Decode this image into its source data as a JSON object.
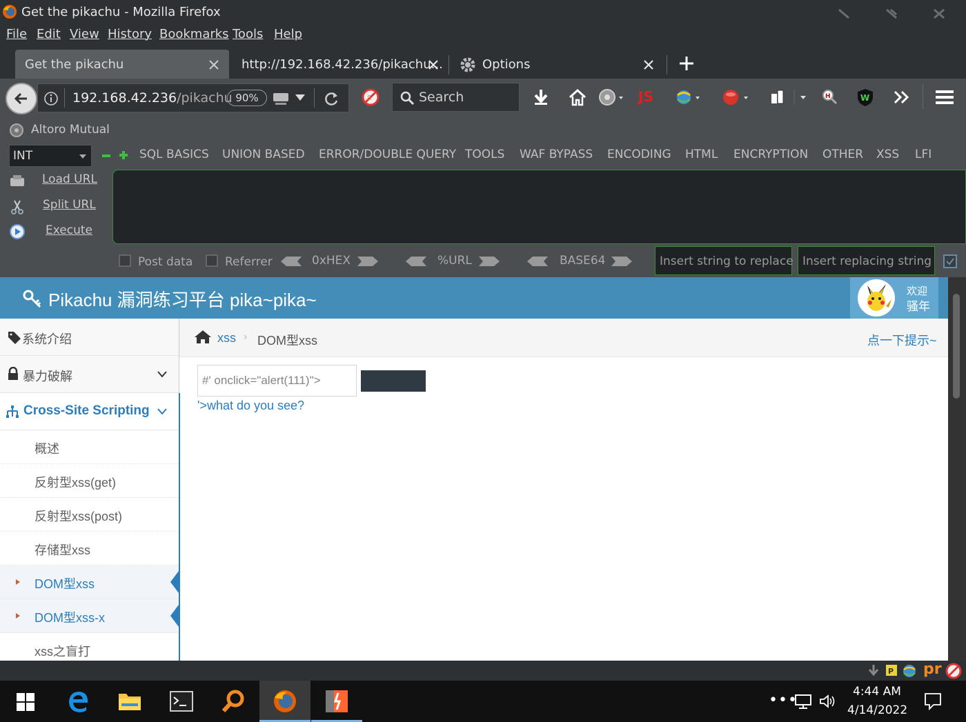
{
  "window": {
    "title": "Get the pikachu - Mozilla Firefox"
  },
  "menu": [
    "File",
    "Edit",
    "View",
    "History",
    "Bookmarks",
    "Tools",
    "Help"
  ],
  "tabs": [
    {
      "label": "Get the pikachu",
      "active": true
    },
    {
      "label": "http://192.168.42.236/pikachu...",
      "active": false
    },
    {
      "label": "Options",
      "active": false
    }
  ],
  "navbar": {
    "url_host": "192.168.42.236",
    "url_path": "/pikachu",
    "zoom": "90%",
    "search_placeholder": "Search",
    "js_label": "JS"
  },
  "bookmarks": {
    "item": "Altoro Mutual"
  },
  "hackbar": {
    "select_value": "INT",
    "menus": [
      "SQL BASICS",
      "UNION BASED",
      "ERROR/DOUBLE QUERY",
      "TOOLS",
      "WAF BYPASS",
      "ENCODING",
      "HTML",
      "ENCRYPTION",
      "OTHER",
      "XSS",
      "LFI"
    ],
    "actions": [
      "Load URL",
      "Split URL",
      "Execute"
    ],
    "options": [
      "Post data",
      "Referrer"
    ],
    "encoders": [
      "0xHEX",
      "%URL",
      "BASE64"
    ],
    "replace_placeholder": "Insert string to replace",
    "replacing_placeholder": "Insert replacing string"
  },
  "page": {
    "brand": "Pikachu 漏洞练习平台 pika~pika~",
    "welcome_line1": "欢迎",
    "welcome_line2": "骚年",
    "sidebar": {
      "items": [
        {
          "label": "系统介绍"
        },
        {
          "label": "暴力破解"
        },
        {
          "label": "Cross-Site Scripting"
        }
      ],
      "subitems": [
        {
          "label": "概述",
          "active": false
        },
        {
          "label": "反射型xss(get)",
          "active": false
        },
        {
          "label": "反射型xss(post)",
          "active": false
        },
        {
          "label": "存储型xss",
          "active": false
        },
        {
          "label": "DOM型xss",
          "active": true
        },
        {
          "label": "DOM型xss-x",
          "active": true
        },
        {
          "label": "xss之盲打",
          "active": false
        }
      ]
    },
    "breadcrumb": {
      "root": "xss",
      "current": "DOM型xss",
      "hint": "点一下提示~"
    },
    "input_value": "#' onclick=\"alert(111)\">",
    "link_text": "'>what do you see?"
  },
  "taskbar": {
    "time": "4:44 AM",
    "date": "4/14/2022"
  },
  "colors": {
    "header_blue": "#438eb9",
    "link_blue": "#2b7dbc"
  }
}
